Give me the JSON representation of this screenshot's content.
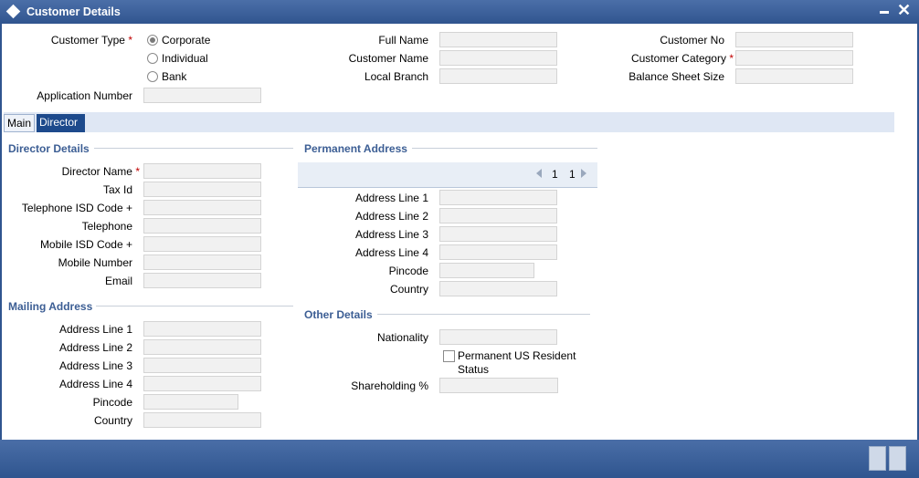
{
  "window": {
    "title": "Customer Details",
    "close_glyph": "✕"
  },
  "header": {
    "customer_type_label": "Customer Type",
    "customer_type_options": [
      "Corporate",
      "Individual",
      "Bank"
    ],
    "selected_customer_type": "Corporate",
    "application_number_label": "Application Number",
    "full_name_label": "Full Name",
    "customer_name_label": "Customer Name",
    "local_branch_label": "Local Branch",
    "customer_no_label": "Customer No",
    "customer_category_label": "Customer Category",
    "balance_sheet_size_label": "Balance Sheet Size",
    "required_mark": "*"
  },
  "tabs": [
    {
      "label": "Main"
    },
    {
      "label": "Director"
    }
  ],
  "active_tab": "Director",
  "director_details": {
    "title": "Director Details",
    "fields": [
      "Director Name",
      "Tax Id",
      "Telephone ISD Code +",
      "Telephone",
      "Mobile ISD Code +",
      "Mobile Number",
      "Email"
    ]
  },
  "mailing_address": {
    "title": "Mailing Address",
    "fields": [
      "Address Line 1",
      "Address Line 2",
      "Address Line 3",
      "Address Line 4",
      "Pincode",
      "Country"
    ]
  },
  "permanent_address": {
    "title": "Permanent Address",
    "pager": {
      "current": "1",
      "total": "1"
    },
    "fields": [
      "Address Line 1",
      "Address Line 2",
      "Address Line 3",
      "Address Line 4",
      "Pincode",
      "Country"
    ]
  },
  "other_details": {
    "title": "Other Details",
    "nationality_label": "Nationality",
    "us_resident_label_1": "Permanent US Resident",
    "us_resident_label_2": "Status",
    "us_resident_checked": false,
    "shareholding_label": "Shareholding %"
  },
  "colors": {
    "title_bar": "#30558f",
    "section_title": "#3c5e94",
    "active_tab": "#1d4a8c",
    "required": "#c00000",
    "input_bg": "#f1f1f1"
  }
}
